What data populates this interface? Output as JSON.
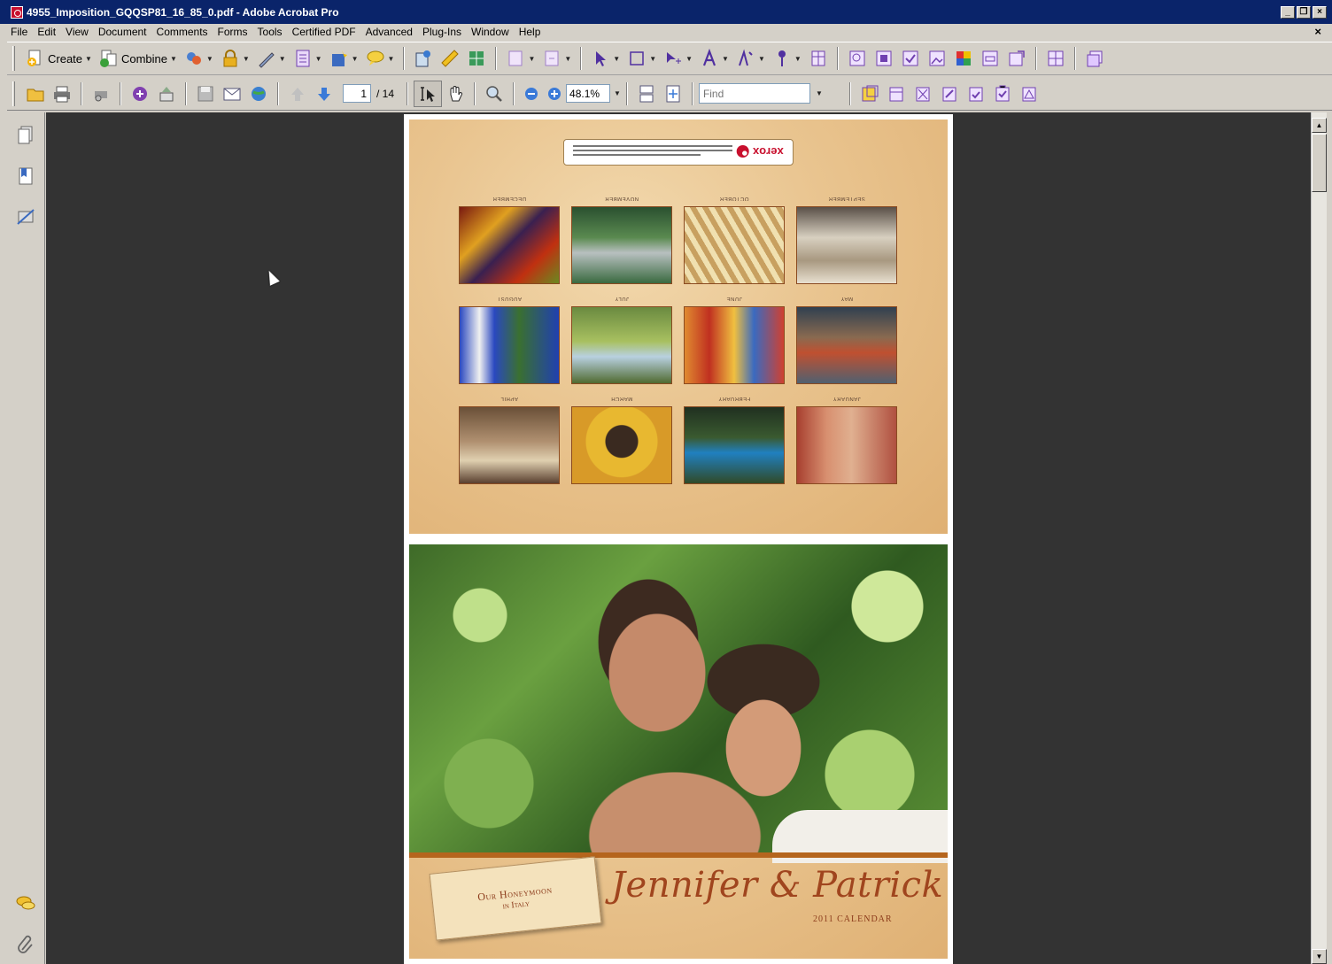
{
  "window": {
    "title": "4955_Imposition_GQQSP81_16_85_0.pdf - Adobe Acrobat Pro",
    "controls": [
      "_",
      "❐",
      "×"
    ]
  },
  "menu": {
    "items": [
      "File",
      "Edit",
      "View",
      "Document",
      "Comments",
      "Forms",
      "Tools",
      "Certified PDF",
      "Advanced",
      "Plug-Ins",
      "Window",
      "Help"
    ],
    "close_glyph": "×"
  },
  "toolbar1": {
    "create_label": "Create",
    "combine_label": "Combine"
  },
  "toolbar2": {
    "current_page": "1",
    "page_count": "/ 14",
    "zoom": "48.1%",
    "find_placeholder": "Find"
  },
  "document": {
    "months": [
      "DECEMBER",
      "NOVEMBER",
      "OCTOBER",
      "SEPTEMBER",
      "AUGUST",
      "JULY",
      "JUNE",
      "MAY",
      "APRIL",
      "MARCH",
      "FEBRUARY",
      "JANUARY"
    ],
    "xerox_label": "xerox",
    "tag_line1": "Our Honeymoon",
    "tag_line2": "in Italy",
    "couple_names": "Jennifer & Patrick",
    "calendar_year": "2011 CALENDAR"
  },
  "colors": {
    "titlebar": "#0a246a",
    "workspace": "#333333",
    "parchment": "#e9c48f",
    "accent_brown": "#a0451e",
    "xerox_red": "#c8102e"
  },
  "icons": [
    "pdf-file-icon",
    "open-folder-icon",
    "print-icon",
    "previous-page-icon",
    "next-page-icon",
    "select-text-icon",
    "hand-tool-icon",
    "zoom-marquee-icon",
    "zoom-out-icon",
    "zoom-in-icon",
    "pages-panel-icon",
    "bookmarks-panel-icon",
    "signatures-panel-icon",
    "comments-panel-icon",
    "attachments-panel-icon"
  ]
}
